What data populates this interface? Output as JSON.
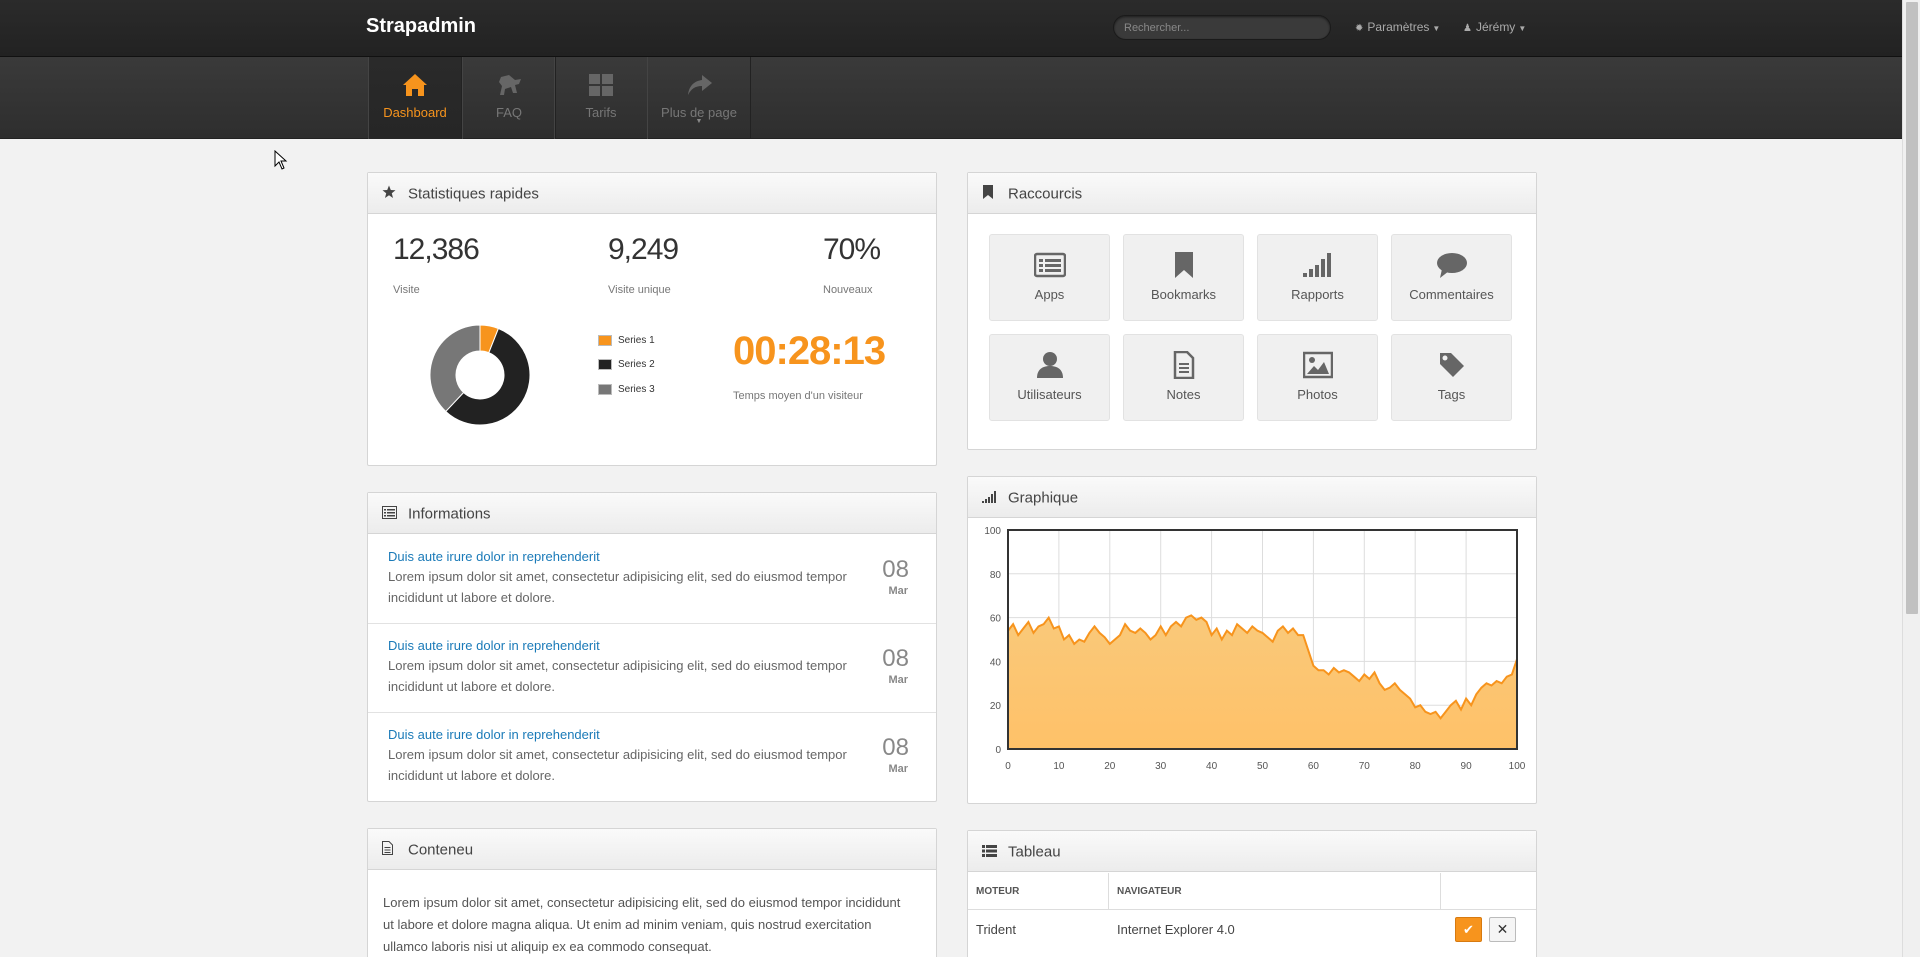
{
  "topbar": {
    "brand": "Strapadmin",
    "search_placeholder": "Rechercher...",
    "menu_settings": "Paramètres",
    "menu_user": "Jérémy"
  },
  "subnav": [
    {
      "label": "Dashboard",
      "icon": "home-icon",
      "active": true
    },
    {
      "label": "FAQ",
      "icon": "horse-icon",
      "active": false
    },
    {
      "label": "Tarifs",
      "icon": "grid-icon",
      "active": false
    },
    {
      "label": "Plus de page",
      "icon": "share-icon",
      "active": false
    }
  ],
  "stats": {
    "title": "Statistiques rapides",
    "items": [
      {
        "value": "12,386",
        "label": "Visite"
      },
      {
        "value": "9,249",
        "label": "Visite unique"
      },
      {
        "value": "70%",
        "label": "Nouveaux"
      }
    ],
    "legend": [
      "Series 1",
      "Series 2",
      "Series 3"
    ],
    "timer": "00:28:13",
    "timer_label": "Temps moyen d'un visiteur"
  },
  "shortcuts": {
    "title": "Raccourcis",
    "items": [
      {
        "label": "Apps",
        "icon": "list-icon"
      },
      {
        "label": "Bookmarks",
        "icon": "bookmark-icon"
      },
      {
        "label": "Rapports",
        "icon": "signal-icon"
      },
      {
        "label": "Commentaires",
        "icon": "comment-icon"
      },
      {
        "label": "Utilisateurs",
        "icon": "user-icon"
      },
      {
        "label": "Notes",
        "icon": "file-icon"
      },
      {
        "label": "Photos",
        "icon": "picture-icon"
      },
      {
        "label": "Tags",
        "icon": "tag-icon"
      }
    ]
  },
  "informations": {
    "title": "Informations",
    "items": [
      {
        "title": "Duis aute irure dolor in reprehenderit",
        "text": "Lorem ipsum dolor sit amet, consectetur adipisicing elit, sed do eiusmod tempor incididunt ut labore et dolore.",
        "day": "08",
        "month": "Mar"
      },
      {
        "title": "Duis aute irure dolor in reprehenderit",
        "text": "Lorem ipsum dolor sit amet, consectetur adipisicing elit, sed do eiusmod tempor incididunt ut labore et dolore.",
        "day": "08",
        "month": "Mar"
      },
      {
        "title": "Duis aute irure dolor in reprehenderit",
        "text": "Lorem ipsum dolor sit amet, consectetur adipisicing elit, sed do eiusmod tempor incididunt ut labore et dolore.",
        "day": "08",
        "month": "Mar"
      }
    ]
  },
  "graphique": {
    "title": "Graphique"
  },
  "contenu": {
    "title": "Conteneu",
    "text": "Lorem ipsum dolor sit amet, consectetur adipisicing elit, sed do eiusmod tempor incididunt ut labore et dolore magna aliqua. Ut enim ad minim veniam, quis nostrud exercitation ullamco laboris nisi ut aliquip ex ea commodo consequat."
  },
  "tableau": {
    "title": "Tableau",
    "headers": [
      "MOTEUR",
      "NAVIGATEUR",
      ""
    ],
    "rows": [
      {
        "moteur": "Trident",
        "navigateur": "Internet Explorer 4.0"
      }
    ]
  },
  "colors": {
    "accent": "#f7941d",
    "link": "#1a7ab8",
    "topbar": "#262626"
  },
  "chart_data": [
    {
      "type": "pie",
      "categories": [
        "Series 1",
        "Series 2",
        "Series 3"
      ],
      "values": [
        6,
        56,
        38
      ],
      "colors": [
        "#f7941d",
        "#222222",
        "#777777"
      ]
    },
    {
      "type": "area",
      "xlim": [
        0,
        100
      ],
      "ylim": [
        0,
        100
      ],
      "x_ticks": [
        0,
        10,
        20,
        30,
        40,
        50,
        60,
        70,
        80,
        90,
        100
      ],
      "y_ticks": [
        0,
        20,
        40,
        60,
        80,
        100
      ],
      "grid": true,
      "color": "#f7941d",
      "x": [
        0,
        1,
        2,
        3,
        4,
        5,
        6,
        7,
        8,
        9,
        10,
        11,
        12,
        13,
        14,
        15,
        16,
        17,
        18,
        19,
        20,
        21,
        22,
        23,
        24,
        25,
        26,
        27,
        28,
        29,
        30,
        31,
        32,
        33,
        34,
        35,
        36,
        37,
        38,
        39,
        40,
        41,
        42,
        43,
        44,
        45,
        46,
        47,
        48,
        49,
        50,
        51,
        52,
        53,
        54,
        55,
        56,
        57,
        58,
        59,
        60,
        61,
        62,
        63,
        64,
        65,
        66,
        67,
        68,
        69,
        70,
        71,
        72,
        73,
        74,
        75,
        76,
        77,
        78,
        79,
        80,
        81,
        82,
        83,
        84,
        85,
        86,
        87,
        88,
        89,
        90,
        91,
        92,
        93,
        94,
        95,
        96,
        97,
        98,
        99,
        100
      ],
      "y": [
        54,
        57,
        52,
        55,
        58,
        53,
        56,
        57,
        60,
        55,
        56,
        50,
        52,
        48,
        50,
        49,
        53,
        56,
        53,
        51,
        48,
        50,
        52,
        57,
        54,
        53,
        55,
        53,
        50,
        52,
        56,
        52,
        56,
        58,
        56,
        60,
        61,
        59,
        60,
        58,
        52,
        55,
        50,
        54,
        52,
        57,
        55,
        53,
        56,
        54,
        53,
        51,
        49,
        54,
        56,
        53,
        55,
        52,
        52,
        45,
        38,
        36,
        36,
        34,
        37,
        35,
        36,
        35,
        33,
        31,
        34,
        32,
        35,
        30,
        27,
        28,
        30,
        27,
        25,
        23,
        19,
        20,
        17,
        16,
        17,
        14,
        17,
        20,
        22,
        18,
        23,
        20,
        25,
        28,
        30,
        29,
        31,
        30,
        33,
        34,
        41
      ]
    }
  ]
}
